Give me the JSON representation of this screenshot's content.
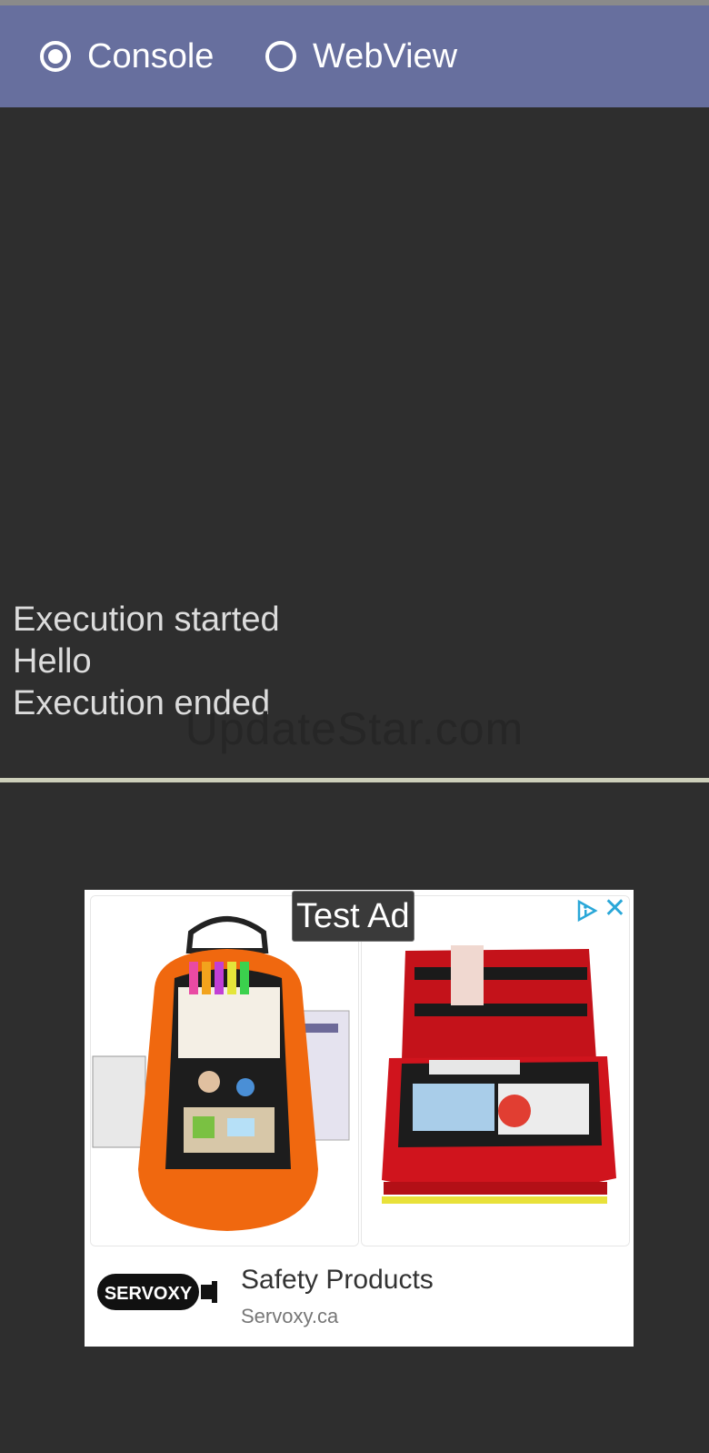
{
  "header": {
    "options": [
      {
        "label": "Console",
        "selected": true
      },
      {
        "label": "WebView",
        "selected": false
      }
    ]
  },
  "console": {
    "lines": [
      "Execution started",
      "Hello",
      "Execution ended"
    ]
  },
  "watermark": "UpdateStar.com",
  "ad": {
    "badge": "Test Ad",
    "title": "Safety Products",
    "url": "Servoxy.ca",
    "logo_text": "SERVOXY"
  },
  "colors": {
    "header": "#676f9e",
    "background": "#2e2e2e",
    "divider": "#cdcfba",
    "adchoices": "#2aa7d8"
  }
}
